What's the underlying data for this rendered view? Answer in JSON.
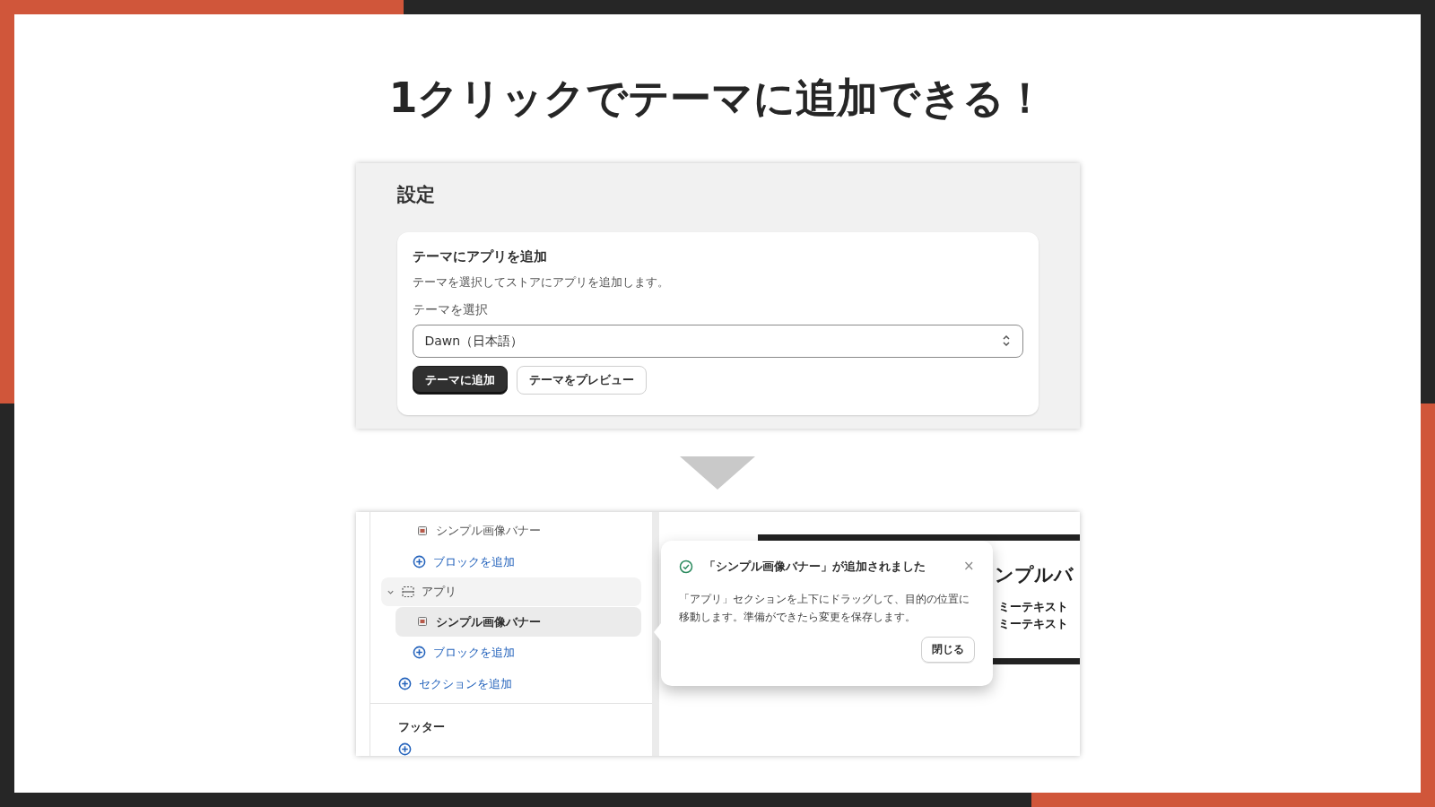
{
  "title": "1クリックでテーマに追加できる！",
  "settings": {
    "heading": "設定",
    "card": {
      "title": "テーマにアプリを追加",
      "description": "テーマを選択してストアにアプリを追加します。",
      "select_label": "テーマを選択",
      "select_value": "Dawn（日本語）",
      "buttons": [
        {
          "label": "テーマに追加",
          "kind": "primary"
        },
        {
          "label": "テーマをプレビュー",
          "kind": "secondary"
        }
      ]
    }
  },
  "editor": {
    "sidebar": {
      "items": [
        {
          "kind": "block",
          "label": "シンプル画像バナー",
          "selected": false
        },
        {
          "kind": "add",
          "label": "ブロックを追加"
        },
        {
          "kind": "section",
          "label": "アプリ",
          "expanded": true,
          "children": [
            {
              "kind": "block",
              "label": "シンプル画像バナー",
              "selected": true
            },
            {
              "kind": "add",
              "label": "ブロックを追加"
            }
          ]
        },
        {
          "kind": "add_section",
          "label": "セクションを追加"
        },
        {
          "kind": "group",
          "label": "フッター"
        },
        {
          "kind": "add_partial"
        }
      ]
    },
    "toast": {
      "title": "「シンプル画像バナー」が追加されました",
      "close": "×",
      "body": "「アプリ」セクションを上下にドラッグして、目的の位置に移動します。準備ができたら変更を保存します。",
      "button": "閉じる"
    },
    "preview": {
      "heading": "ンプルバ",
      "lines": [
        "ミーテキスト",
        "ミーテキスト"
      ]
    }
  }
}
